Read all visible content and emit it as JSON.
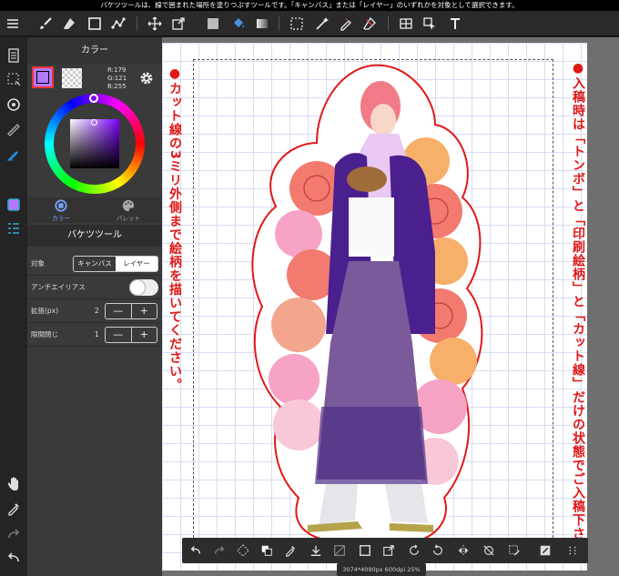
{
  "hint_text": "バケツツールは、線で囲まれた場所を塗りつぶすツールです。「キャンバス」または「レイヤー」のいずれかを対象として選択できます。",
  "panel": {
    "title": "カラー",
    "color": {
      "r_label": "R:179",
      "g_label": "G:121",
      "b_label": "B:255",
      "main_hex": "#b379ff"
    },
    "tabs": [
      {
        "label": "カラー",
        "icon": "color-wheel-icon"
      },
      {
        "label": "パレット",
        "icon": "palette-icon"
      }
    ]
  },
  "tool": {
    "title": "バケツツール",
    "target": {
      "label": "対象",
      "options": [
        "キャンバス",
        "レイヤー"
      ],
      "selected": "レイヤー"
    },
    "antialias": {
      "label": "アンチエイリアス",
      "on": true
    },
    "expand": {
      "label": "拡張(px)",
      "value": "2"
    },
    "gap_close": {
      "label": "隙間閉じ",
      "value": "1"
    },
    "stepper_minus": "—",
    "stepper_plus": "+"
  },
  "canvas": {
    "left_note": "●カット線の3ミリ外側まで絵柄を描いてください。",
    "right_note": "●入稿時は「トンボ」と「印刷絵柄」と「カット線」だけの状態でご入稿下さい。",
    "info": "3074*4090px 600dpi 25%"
  },
  "colors": {
    "accent": "#e01818",
    "toolbar": "#2a2a2a",
    "panel": "#3a3a3a"
  }
}
